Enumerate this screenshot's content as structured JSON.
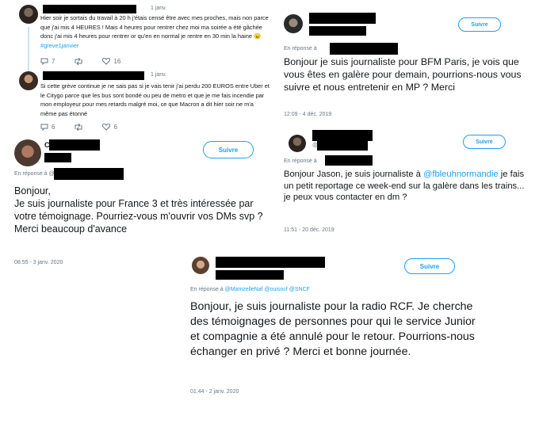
{
  "thread": {
    "tweet1": {
      "date": "1 janv.",
      "text_plain": "Hier soir je sortais du travail à 20 h j'étais censé être avec mes proches, mais non parce que j'ai mis 4 HEURES ! Mais 4 heures pour rentrer chez moi ma soirée a été gâchée donc j'ai mis 4 heures pour rentrer or qu'en en normal je rentre en 30 min la haine",
      "emoji": "😠",
      "hashtag": "#greve1janvier",
      "reply_count": "7",
      "like_count": "16"
    },
    "tweet2": {
      "date": "1 janv.",
      "text": "Si cette grève continue je ne sais pas si je vais tenir j'ai perdu 200 EUROS entre Uber et le Citygo parce que les bus sont bondé ou peu de metro et que je me fais incendie par mon employeur pour mes retards malgré moi, ce que Macron a dit hier soir ne m'a même pas étonné",
      "reply_count": "6",
      "like_count": "6"
    }
  },
  "france3": {
    "initial": "C",
    "follow_label": "Suivre",
    "reply_prefix": "En réponse à @",
    "text": "Bonjour,\nJe suis journaliste pour France 3 et très intéressée par votre témoignage. Pourriez-vous m'ouvrir vos DMs svp ?\nMerci beaucoup d'avance",
    "date": "08:55 - 3 janv. 2020"
  },
  "bfm": {
    "follow_label": "Suivre",
    "reply_prefix": "En réponse à",
    "text": "Bonjour je suis journaliste pour BFM Paris, je vois que vous êtes en galère pour demain, pourrions-nous vous suivre et nous entretenir en MP ? Merci",
    "date": "12:09 - 4 déc. 2019"
  },
  "jason": {
    "follow_label": "Suivre",
    "handle_start": "@",
    "reply_prefix": "En réponse à",
    "text_before": "Bonjour Jason, je suis journaliste à ",
    "mention": "@fbleuhnormandie",
    "text_after": " je fais un petit reportage ce week-end sur la galère dans les trains... je peux vous contacter en dm ?",
    "date": "11:51 - 20 déc. 2019"
  },
  "rcf": {
    "follow_label": "Suivre",
    "reply_prefix": "En réponse à",
    "reply_handles": "@MamzelleNaf @ouisncf @SNCF",
    "text": "Bonjour, je suis journaliste pour la radio RCF. Je cherche des témoignages de personnes pour qui le service Junior et compagnie a été annulé pour le retour. Pourrions-nous échanger en privé ? Merci et bonne journée.",
    "date": "01:44 - 2 janv. 2020"
  },
  "colors": {
    "accent": "#1da1f2",
    "muted": "#657786",
    "text": "#14171a",
    "redaction": "#000000"
  },
  "icons": [
    "reply-icon",
    "retweet-icon",
    "like-icon"
  ]
}
